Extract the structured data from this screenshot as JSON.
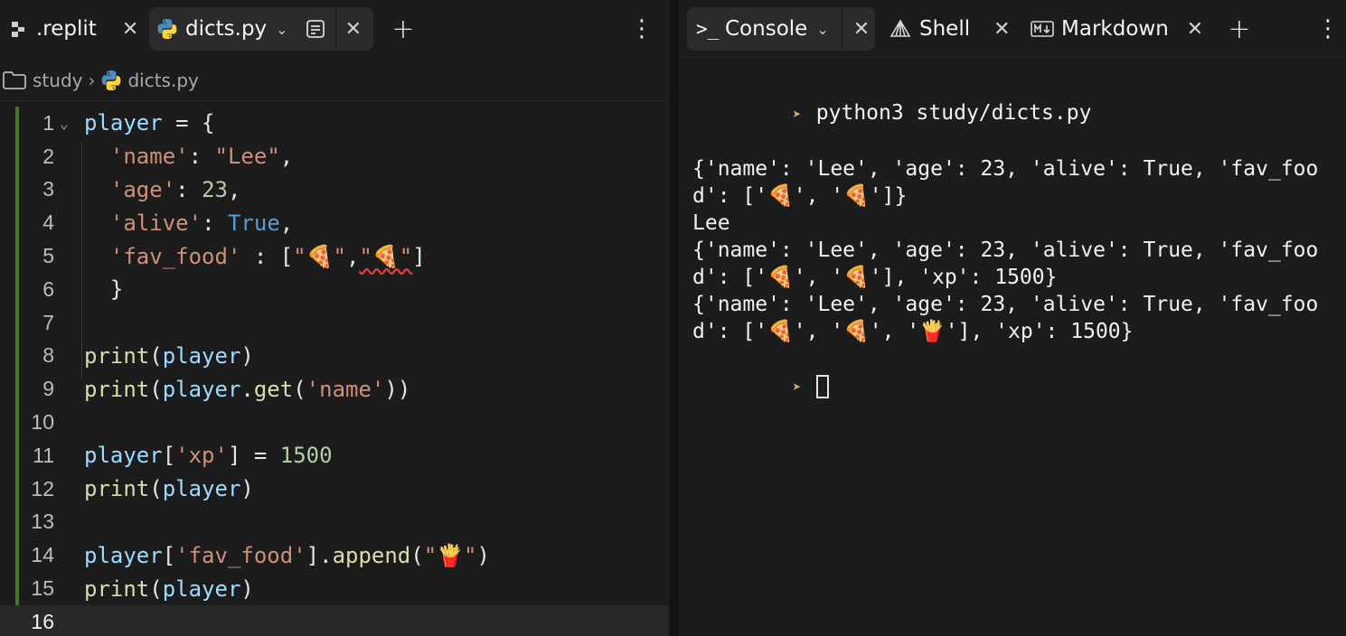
{
  "editor": {
    "tabs": [
      {
        "label": ".replit",
        "icon": "replit-config-icon"
      },
      {
        "label": "dicts.py",
        "icon": "python-icon",
        "active": true
      }
    ],
    "new_tab_symbol": "+",
    "more_symbol": "⋮",
    "breadcrumb": {
      "folder": "study",
      "file": "dicts.py"
    },
    "current_line": 16
  },
  "console": {
    "tabs": [
      {
        "label": "Console",
        "icon": "terminal-icon",
        "active": true
      },
      {
        "label": "Shell",
        "icon": "shell-icon"
      },
      {
        "label": "Markdown",
        "icon": "markdown-icon"
      }
    ],
    "command": "python3 study/dicts.py",
    "output_lines": [
      "{'name': 'Lee', 'age': 23, 'alive': True, 'fav_foo",
      "d': ['🍕', '🍕']}",
      "Lee",
      "{'name': 'Lee', 'age': 23, 'alive': True, 'fav_foo",
      "d': ['🍕', '🍕'], 'xp': 1500}",
      "{'name': 'Lee', 'age': 23, 'alive': True, 'fav_foo",
      "d': ['🍕', '🍕', '🍟'], 'xp': 1500}"
    ]
  },
  "code_lines": [
    {
      "n": "1",
      "fold": true,
      "tokens": [
        [
          "c-var",
          "player"
        ],
        [
          "c-p",
          " = {"
        ]
      ]
    },
    {
      "n": "2",
      "tokens": [
        [
          "c-p",
          "  "
        ],
        [
          "c-str",
          "'name'"
        ],
        [
          "c-p",
          ": "
        ],
        [
          "c-str",
          "\"Lee\""
        ],
        [
          "c-p",
          ","
        ]
      ]
    },
    {
      "n": "3",
      "tokens": [
        [
          "c-p",
          "  "
        ],
        [
          "c-str",
          "'age'"
        ],
        [
          "c-p",
          ": "
        ],
        [
          "c-num",
          "23"
        ],
        [
          "c-p",
          ","
        ]
      ]
    },
    {
      "n": "4",
      "tokens": [
        [
          "c-p",
          "  "
        ],
        [
          "c-str",
          "'alive'"
        ],
        [
          "c-p",
          ": "
        ],
        [
          "c-kw",
          "True"
        ],
        [
          "c-p",
          ","
        ]
      ]
    },
    {
      "n": "5",
      "tokens": [
        [
          "c-p",
          "  "
        ],
        [
          "c-str",
          "'fav_food'"
        ],
        [
          "c-p",
          " : ["
        ],
        [
          "c-str",
          "\"🍕\""
        ],
        [
          "c-p",
          ","
        ],
        [
          "c-str squiggle",
          "\"🍕\""
        ],
        [
          "c-p",
          "]"
        ]
      ]
    },
    {
      "n": "6",
      "tokens": [
        [
          "c-p",
          "  }"
        ]
      ]
    },
    {
      "n": "7",
      "tokens": []
    },
    {
      "n": "8",
      "tokens": [
        [
          "c-fn",
          "print"
        ],
        [
          "c-p",
          "("
        ],
        [
          "c-var",
          "player"
        ],
        [
          "c-p",
          ")"
        ]
      ]
    },
    {
      "n": "9",
      "tokens": [
        [
          "c-fn",
          "print"
        ],
        [
          "c-p",
          "("
        ],
        [
          "c-var",
          "player"
        ],
        [
          "c-p",
          "."
        ],
        [
          "c-fn",
          "get"
        ],
        [
          "c-p",
          "("
        ],
        [
          "c-str",
          "'name'"
        ],
        [
          "c-p",
          "))"
        ]
      ]
    },
    {
      "n": "10",
      "tokens": []
    },
    {
      "n": "11",
      "tokens": [
        [
          "c-var",
          "player"
        ],
        [
          "c-p",
          "["
        ],
        [
          "c-str",
          "'xp'"
        ],
        [
          "c-p",
          "] = "
        ],
        [
          "c-num",
          "1500"
        ]
      ]
    },
    {
      "n": "12",
      "tokens": [
        [
          "c-fn",
          "print"
        ],
        [
          "c-p",
          "("
        ],
        [
          "c-var",
          "player"
        ],
        [
          "c-p",
          ")"
        ]
      ]
    },
    {
      "n": "13",
      "tokens": []
    },
    {
      "n": "14",
      "tokens": [
        [
          "c-var",
          "player"
        ],
        [
          "c-p",
          "["
        ],
        [
          "c-str",
          "'fav_food'"
        ],
        [
          "c-p",
          "]."
        ],
        [
          "c-fn",
          "append"
        ],
        [
          "c-p",
          "("
        ],
        [
          "c-str",
          "\"🍟\""
        ],
        [
          "c-p",
          ")"
        ]
      ]
    },
    {
      "n": "15",
      "tokens": [
        [
          "c-fn",
          "print"
        ],
        [
          "c-p",
          "("
        ],
        [
          "c-var",
          "player"
        ],
        [
          "c-p",
          ")"
        ]
      ]
    },
    {
      "n": "16",
      "tokens": []
    }
  ]
}
